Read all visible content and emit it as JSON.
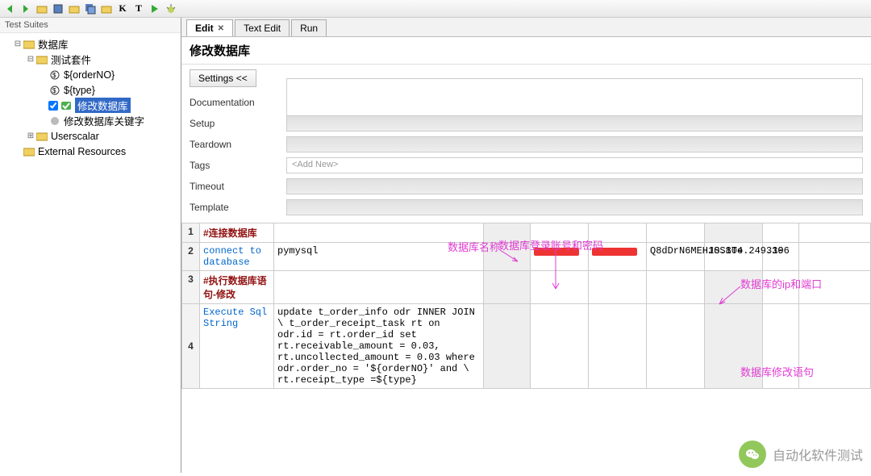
{
  "sidebar": {
    "title": "Test Suites",
    "root": "数据库",
    "suite": "测试套件",
    "items": [
      "${orderNO}",
      "${type}",
      "修改数据库",
      "修改数据库关键字"
    ],
    "userscalar": "Userscalar",
    "external": "External Resources"
  },
  "tabs": {
    "edit": "Edit",
    "textedit": "Text Edit",
    "run": "Run"
  },
  "page": {
    "title": "修改数据库",
    "settings": "Settings <<",
    "props": {
      "doc": "Documentation",
      "setup": "Setup",
      "teardown": "Teardown",
      "tags": "Tags",
      "timeout": "Timeout",
      "template": "Template",
      "addnew": "<Add New>"
    }
  },
  "grid": {
    "r1c1": "#连接数据库",
    "r2kw": "connect to database",
    "r2a1": "pymysql",
    "r2a4": "Q8dDrN6MEHJSS8Te",
    "r2a5": "10.104.249.19",
    "r2a6": "3306",
    "r3c1": "#执行数据库语句-修改",
    "r4kw": "Execute Sql String",
    "r4a1": "update t_order_info odr INNER JOIN \\ t_order_receipt_task rt on odr.id = rt.order_id set rt.receivable_amount = 0.03, rt.uncollected_amount = 0.03 where odr.order_no = '${orderNO}' and \\ rt.receipt_type =${type}"
  },
  "annot": {
    "dbname": "数据库名称",
    "credentials": "数据库登录账号和密码",
    "ipport": "数据库的ip和端口",
    "sql": "数据库修改语句"
  },
  "watermark": "自动化软件测试"
}
